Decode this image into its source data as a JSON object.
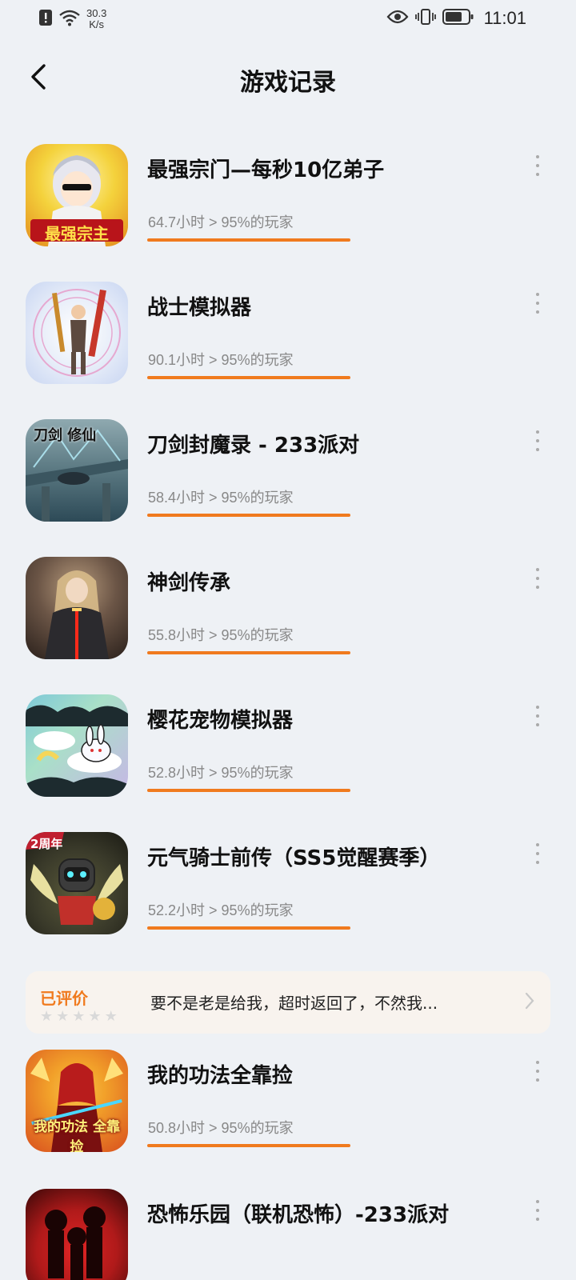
{
  "status_bar": {
    "net_speed_value": "30.3",
    "net_speed_unit": "K/s",
    "time": "11:01",
    "icons": [
      "alert-icon",
      "wifi-icon",
      "eye-icon",
      "vibrate-icon",
      "battery-icon"
    ]
  },
  "header": {
    "title": "游戏记录",
    "back_icon": "back-arrow-icon"
  },
  "games": [
    {
      "name": "最强宗门—每秒10亿弟子",
      "stat": "64.7小时 > 95%的玩家",
      "icon_text": "最强宗主",
      "colors": [
        "#f4d23c",
        "#e38b1e"
      ]
    },
    {
      "name": "战士模拟器",
      "stat": "90.1小时 > 95%的玩家",
      "icon_text": "",
      "colors": [
        "#e8eef9",
        "#c9d6f2"
      ]
    },
    {
      "name": "刀剑封魔录 - 233派对",
      "stat": "58.4小时 > 95%的玩家",
      "icon_text": "刀剑 修仙",
      "colors": [
        "#5f7d86",
        "#2d4a57"
      ]
    },
    {
      "name": "神剑传承",
      "stat": "55.8小时 > 95%的玩家",
      "icon_text": "",
      "colors": [
        "#6b5546",
        "#2a201b"
      ]
    },
    {
      "name": "樱花宠物模拟器",
      "stat": "52.8小时 > 95%的玩家",
      "icon_text": "",
      "colors": [
        "#7ec9d8",
        "#c7b6e6"
      ]
    },
    {
      "name": "元气骑士前传（SS5觉醒赛季）",
      "stat": "52.2小时 > 95%的玩家",
      "icon_text": "2周年",
      "colors": [
        "#3a3a2a",
        "#b13a2a"
      ]
    }
  ],
  "review": {
    "label": "已评价",
    "text": "要不是老是给我，超时返回了，不然我...",
    "stars": 0
  },
  "games_after_review": [
    {
      "name": "我的功法全靠捡",
      "stat": "50.8小时 > 95%的玩家",
      "icon_text": "我的功法 全靠捡",
      "colors": [
        "#d9501e",
        "#f2a12a"
      ]
    },
    {
      "name": "恐怖乐园（联机恐怖）-233派对",
      "stat": "",
      "icon_text": "",
      "colors": [
        "#b01a1a",
        "#3a0808"
      ]
    }
  ],
  "colors": {
    "accent": "#f07a1e",
    "background": "#eef1f5",
    "review_bg": "#f8f3ee"
  }
}
